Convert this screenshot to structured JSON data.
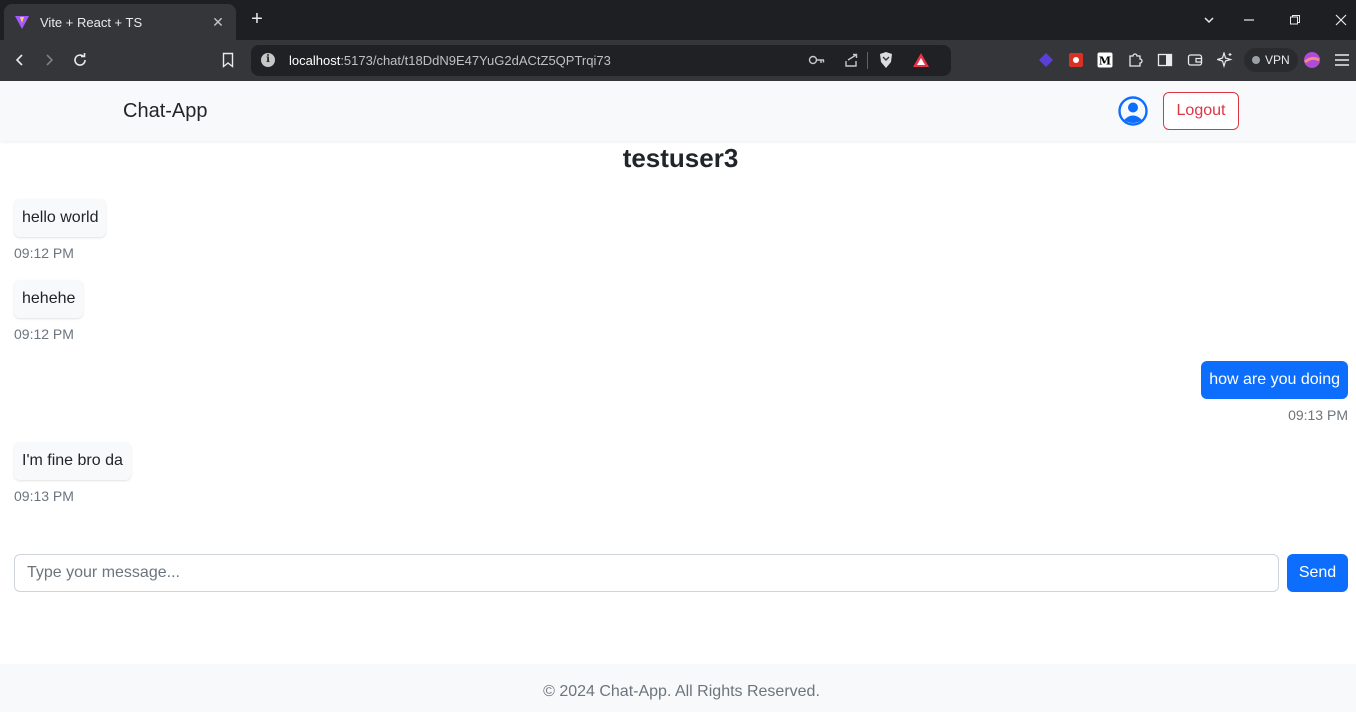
{
  "browser": {
    "tab_title": "Vite + React + TS",
    "url_host": "localhost",
    "url_path": ":5173/chat/t18DdN9E47YuG2dACtZ5QPTrqi73",
    "vpn_label": "VPN"
  },
  "app": {
    "brand": "Chat-App",
    "logout_label": "Logout",
    "chat_title": "testuser3",
    "messages": [
      {
        "text": "hello world",
        "time": "09:12 PM",
        "direction": "incoming"
      },
      {
        "text": "hehehe",
        "time": "09:12 PM",
        "direction": "incoming"
      },
      {
        "text": "how are you doing",
        "time": "09:13 PM",
        "direction": "outgoing"
      },
      {
        "text": "I'm fine bro da",
        "time": "09:13 PM",
        "direction": "incoming"
      }
    ],
    "input_placeholder": "Type your message...",
    "send_label": "Send",
    "footer": "© 2024 Chat-App. All Rights Reserved."
  },
  "colors": {
    "primary": "#0d6efd",
    "danger": "#dc3545",
    "navbar_bg": "#f8f9fa"
  }
}
